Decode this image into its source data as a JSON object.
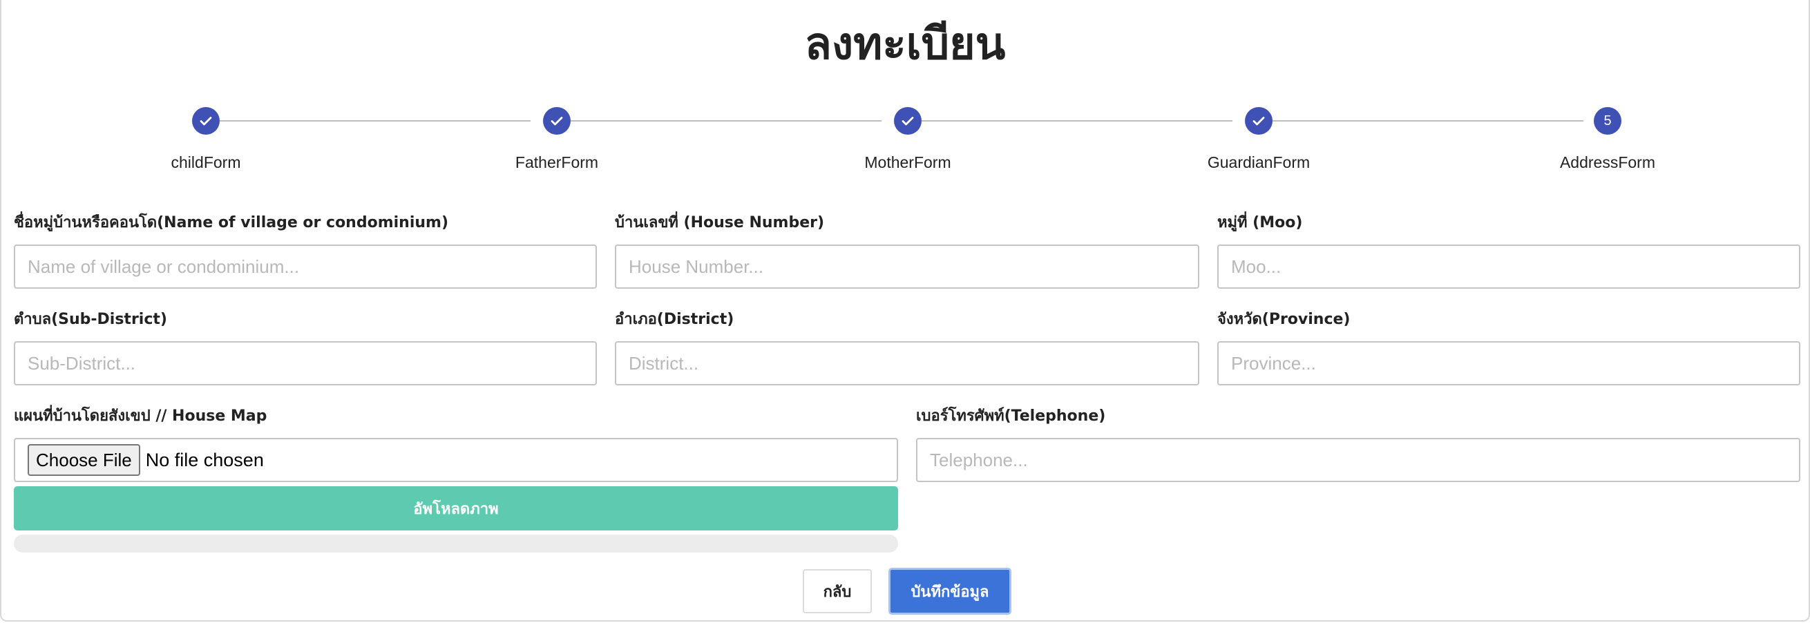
{
  "page": {
    "title": "ลงทะเบียน"
  },
  "stepper": {
    "steps": [
      {
        "label": "childForm",
        "state": "completed",
        "icon": "check-icon"
      },
      {
        "label": "FatherForm",
        "state": "completed",
        "icon": "check-icon"
      },
      {
        "label": "MotherForm",
        "state": "completed",
        "icon": "check-icon"
      },
      {
        "label": "GuardianForm",
        "state": "completed",
        "icon": "check-icon"
      },
      {
        "label": "AddressForm",
        "state": "active",
        "number": "5"
      }
    ],
    "active_color": "#3f51b5"
  },
  "form": {
    "village": {
      "label": "ชื่อหมู่บ้านหรือคอนโด(Name of village or condominium)",
      "placeholder": "Name of village or condominium...",
      "value": ""
    },
    "house_number": {
      "label": "บ้านเลขที่ (House Number)",
      "placeholder": "House Number...",
      "value": ""
    },
    "moo": {
      "label": "หมู่ที่ (Moo)",
      "placeholder": "Moo...",
      "value": ""
    },
    "sub_district": {
      "label": "ตำบล(Sub-District)",
      "placeholder": "Sub-District...",
      "value": ""
    },
    "district": {
      "label": "อำเภอ(District)",
      "placeholder": "District...",
      "value": ""
    },
    "province": {
      "label": "จังหวัด(Province)",
      "placeholder": "Province...",
      "value": ""
    },
    "house_map": {
      "label": "แผนที่บ้านโดยสังเขป // House Map",
      "choose_label": "Choose File",
      "status": "No file chosen"
    },
    "telephone": {
      "label": "เบอร์โทรศัพท์(Telephone)",
      "placeholder": "Telephone...",
      "value": ""
    },
    "upload_label": "อัพโหลดภาพ",
    "upload_progress": 0
  },
  "actions": {
    "back_label": "กลับ",
    "save_label": "บันทึกข้อมูล"
  },
  "colors": {
    "upload_button": "#5ecbb0",
    "save_button": "#3b73d9",
    "stepper": "#3f51b5"
  }
}
